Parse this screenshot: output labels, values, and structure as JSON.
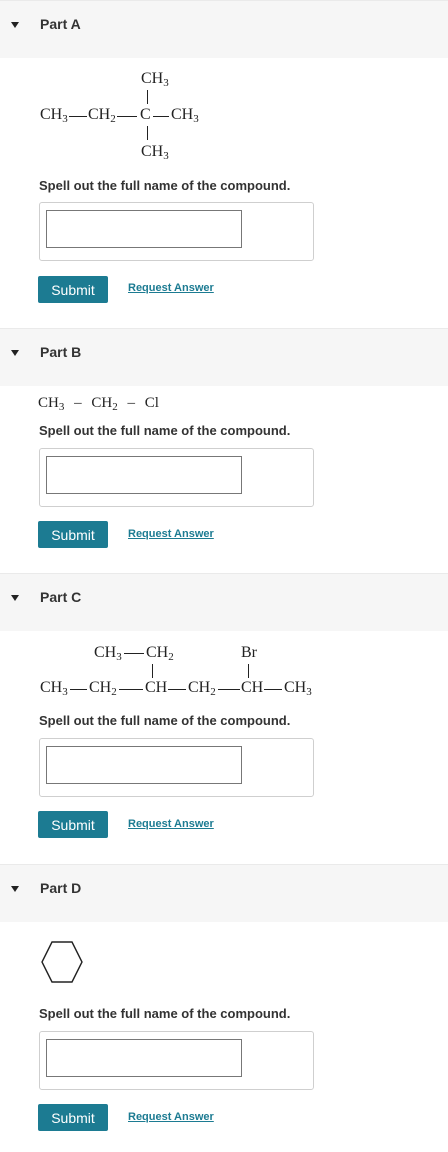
{
  "parts": [
    {
      "title": "Part A",
      "question": "Spell out the full name of the compound.",
      "submit_label": "Submit",
      "request_label": "Request Answer",
      "input_value": "",
      "structure": {
        "top_group": "CH",
        "left_chain": "CH",
        "left_chain2": "CH",
        "center": "C",
        "right_group": "CH",
        "bottom_group": "CH",
        "subscript3": "3",
        "subscript2": "2"
      }
    },
    {
      "title": "Part B",
      "question": "Spell out the full name of the compound.",
      "submit_label": "Submit",
      "request_label": "Request Answer",
      "input_value": "",
      "structure": {
        "formula_a": "CH",
        "sub_a": "3",
        "dash1": "–",
        "formula_b": "CH",
        "sub_b": "2",
        "dash2": "–",
        "formula_c": "Cl"
      }
    },
    {
      "title": "Part C",
      "question": "Spell out the full name of the compound.",
      "submit_label": "Submit",
      "request_label": "Request Answer",
      "input_value": "",
      "structure": {
        "branch1": "CH",
        "branch2": "CH",
        "branch_br": "Br",
        "main1": "CH",
        "main2": "CH",
        "main3": "CH",
        "main4": "CH",
        "main5": "CH",
        "main6": "CH",
        "subscript3": "3",
        "subscript2": "2"
      }
    },
    {
      "title": "Part D",
      "question": "Spell out the full name of the compound.",
      "submit_label": "Submit",
      "request_label": "Request Answer",
      "input_value": "",
      "structure": {
        "shape": "hexagon-icon"
      }
    }
  ],
  "colors": {
    "accent": "#1c7b92",
    "header_bg": "#f6f6f6"
  }
}
